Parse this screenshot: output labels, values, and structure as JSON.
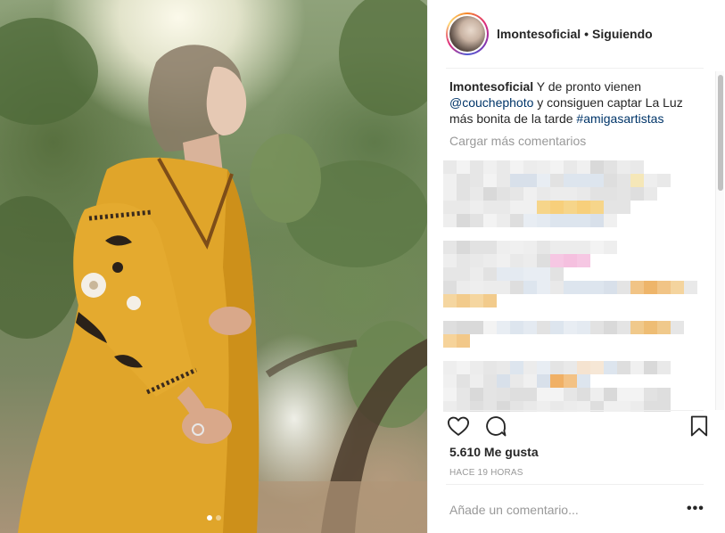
{
  "post": {
    "username": "lmontesoficial",
    "separator": "•",
    "follow_state": "Siguiendo",
    "caption": {
      "user": "lmontesoficial",
      "text_1": " Y de pronto vienen ",
      "mention": "@couchephoto",
      "text_2": " y consiguen captar La Luz más bonita de la tarde ",
      "hashtag": "#amigasartistas"
    },
    "load_more": "Cargar más comentarios",
    "likes": "5.610 Me gusta",
    "time": "HACE 19 HORAS",
    "comment_placeholder": "Añade un comentario...",
    "more_options": "•••",
    "carousel": {
      "count": 2,
      "active": 1
    }
  },
  "icons": {
    "like": "heart-icon",
    "comment": "comment-bubble-icon",
    "save": "bookmark-icon",
    "more": "more-options-icon"
  },
  "colors": {
    "link": "#003569",
    "secondary_text": "#999999",
    "primary_text": "#262626",
    "divider": "#efefef"
  }
}
